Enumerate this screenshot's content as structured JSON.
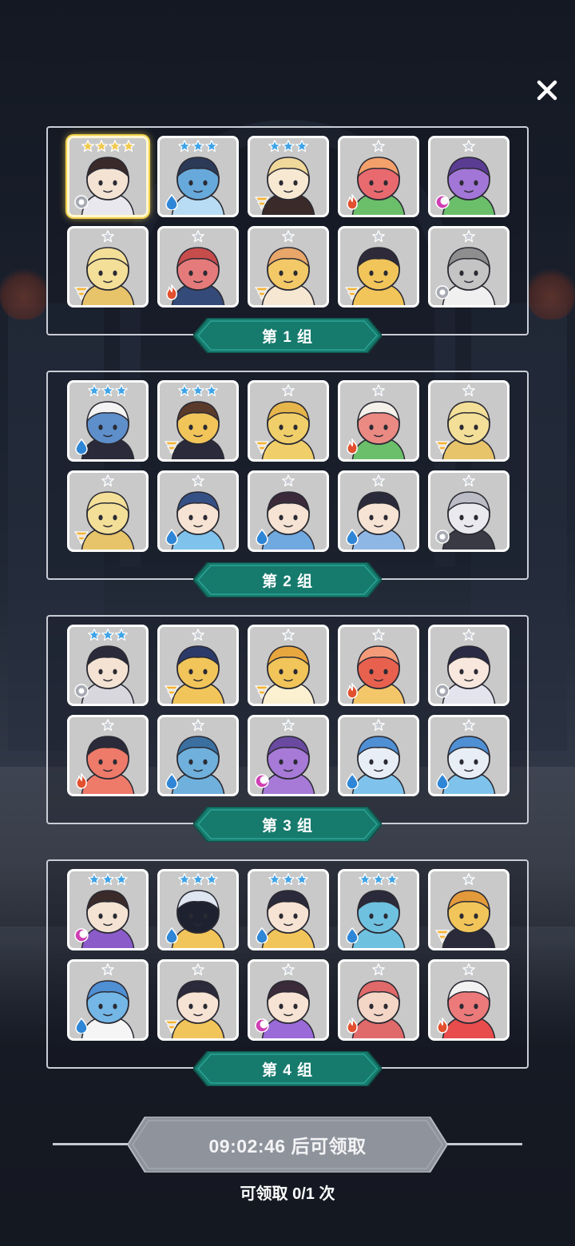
{
  "close_label": "✕",
  "groups": [
    {
      "label": "第 1 组",
      "heroes": [
        {
          "name": "hero-ninja-white-mask",
          "stars": 4,
          "star_color": "gold",
          "element": "light",
          "skin": "#f4e3d3",
          "hair": "#3a2a2a",
          "accent": "#e8e8ee",
          "highlight": true
        },
        {
          "name": "hero-blue-dragon",
          "stars": 3,
          "star_color": "blue",
          "element": "water",
          "skin": "#67a9da",
          "hair": "#2c3a57",
          "accent": "#b8dcf3"
        },
        {
          "name": "hero-blonde-boy",
          "stars": 3,
          "star_color": "blue",
          "element": "earth",
          "skin": "#f7e8d2",
          "hair": "#f0d79a",
          "accent": "#3a2a2a"
        },
        {
          "name": "hero-red-chomper",
          "stars": 1,
          "star_color": "silver",
          "element": "fire",
          "skin": "#e86a6f",
          "hair": "#f4a06b",
          "accent": "#6bbf6a"
        },
        {
          "name": "hero-purple-chomper",
          "stars": 1,
          "star_color": "silver",
          "element": "dark",
          "skin": "#a276d6",
          "hair": "#5b3c93",
          "accent": "#6bbf6a"
        },
        {
          "name": "hero-yellow-blob",
          "stars": 1,
          "star_color": "silver",
          "element": "earth",
          "skin": "#f3df98",
          "hair": "#f3df98",
          "accent": "#e7c46a"
        },
        {
          "name": "hero-red-cat",
          "stars": 1,
          "star_color": "silver",
          "element": "fire",
          "skin": "#e57a7a",
          "hair": "#c74c4c",
          "accent": "#344a78"
        },
        {
          "name": "hero-pizza-blob",
          "stars": 1,
          "star_color": "silver",
          "element": "earth",
          "skin": "#f3c968",
          "hair": "#e9a66a",
          "accent": "#f5e7d2"
        },
        {
          "name": "hero-yellow-king",
          "stars": 1,
          "star_color": "silver",
          "element": "earth",
          "skin": "#f2c55a",
          "hair": "#2e2a3a",
          "accent": "#f2c55a"
        },
        {
          "name": "hero-gray-mummy",
          "stars": 1,
          "star_color": "silver",
          "element": "light",
          "skin": "#c4c4c4",
          "hair": "#8e8e8e",
          "accent": "#f0f0f0"
        }
      ]
    },
    {
      "label": "第 2 组",
      "heroes": [
        {
          "name": "hero-blue-bandaged",
          "stars": 3,
          "star_color": "blue",
          "element": "water",
          "skin": "#5e8fca",
          "hair": "#f3f3f3",
          "accent": "#2a2a3a"
        },
        {
          "name": "hero-yellow-tree",
          "stars": 3,
          "star_color": "blue",
          "element": "earth",
          "skin": "#f2c55a",
          "hair": "#5a3a2a",
          "accent": "#2a2a3a"
        },
        {
          "name": "hero-yellow-fluff",
          "stars": 1,
          "star_color": "silver",
          "element": "earth",
          "skin": "#f0cf6a",
          "hair": "#e6b54b",
          "accent": "#f0cf6a"
        },
        {
          "name": "hero-red-bandaged",
          "stars": 1,
          "star_color": "silver",
          "element": "fire",
          "skin": "#ea8a83",
          "hair": "#f4f0ea",
          "accent": "#6bbf6a"
        },
        {
          "name": "hero-yellow-blob-b",
          "stars": 1,
          "star_color": "silver",
          "element": "earth",
          "skin": "#f3df98",
          "hair": "#f3df98",
          "accent": "#e7c46a"
        },
        {
          "name": "hero-yellow-blob-c",
          "stars": 1,
          "star_color": "silver",
          "element": "earth",
          "skin": "#f3df98",
          "hair": "#f3df98",
          "accent": "#e7c46a"
        },
        {
          "name": "hero-blue-visor-knight",
          "stars": 1,
          "star_color": "silver",
          "element": "water",
          "skin": "#f7e3d3",
          "hair": "#355085",
          "accent": "#7fc3ec"
        },
        {
          "name": "hero-blue-witch",
          "stars": 1,
          "star_color": "silver",
          "element": "water",
          "skin": "#f7e3d3",
          "hair": "#3a2a3a",
          "accent": "#6fa9e0"
        },
        {
          "name": "hero-armored-knight",
          "stars": 1,
          "star_color": "silver",
          "element": "water",
          "skin": "#f7e3d3",
          "hair": "#2a2a3a",
          "accent": "#8fb7e6"
        },
        {
          "name": "hero-white-helmet",
          "stars": 1,
          "star_color": "silver",
          "element": "light",
          "skin": "#e9e9ee",
          "hair": "#bcbcc6",
          "accent": "#3a3a44"
        }
      ]
    },
    {
      "label": "第 3 组",
      "heroes": [
        {
          "name": "hero-dark-ponytail",
          "stars": 3,
          "star_color": "blue",
          "element": "light",
          "skin": "#f4e3d3",
          "hair": "#2a2a3a",
          "accent": "#d7d7dd"
        },
        {
          "name": "hero-yellow-skull",
          "stars": 1,
          "star_color": "silver",
          "element": "earth",
          "skin": "#f2c55a",
          "hair": "#2c3a6a",
          "accent": "#f2c55a"
        },
        {
          "name": "hero-yellow-lion",
          "stars": 1,
          "star_color": "silver",
          "element": "earth",
          "skin": "#f2c55a",
          "hair": "#e8a63e",
          "accent": "#fbf0d0"
        },
        {
          "name": "hero-red-phoenix",
          "stars": 1,
          "star_color": "silver",
          "element": "fire",
          "skin": "#e8614f",
          "hair": "#f49c7a",
          "accent": "#f4c66a"
        },
        {
          "name": "hero-black-hair-girl",
          "stars": 1,
          "star_color": "silver",
          "element": "light",
          "skin": "#f7e7dd",
          "hair": "#2a2a44",
          "accent": "#e4e4ee"
        },
        {
          "name": "hero-red-fortress",
          "stars": 1,
          "star_color": "silver",
          "element": "fire",
          "skin": "#ee7a6a",
          "hair": "#2a2a3a",
          "accent": "#ee7a6a"
        },
        {
          "name": "hero-blue-key",
          "stars": 1,
          "star_color": "silver",
          "element": "water",
          "skin": "#6fb0dc",
          "hair": "#3a6fa0",
          "accent": "#6fb0dc"
        },
        {
          "name": "hero-purple-key",
          "stars": 1,
          "star_color": "silver",
          "element": "dark",
          "skin": "#a77ad8",
          "hair": "#6a4aa0",
          "accent": "#a77ad8"
        },
        {
          "name": "hero-blue-mech-a",
          "stars": 1,
          "star_color": "silver",
          "element": "water",
          "skin": "#e8eef6",
          "hair": "#4f8fd3",
          "accent": "#7fc3ec"
        },
        {
          "name": "hero-blue-mech-b",
          "stars": 1,
          "star_color": "silver",
          "element": "water",
          "skin": "#e8eef6",
          "hair": "#4f8fd3",
          "accent": "#7fc3ec"
        }
      ]
    },
    {
      "label": "第 4 组",
      "heroes": [
        {
          "name": "hero-purple-mask-ninja",
          "stars": 3,
          "star_color": "blue",
          "element": "dark",
          "skin": "#f4e3d3",
          "hair": "#3a2a2a",
          "accent": "#8a5bc9"
        },
        {
          "name": "hero-hooded-mage",
          "stars": 3,
          "star_color": "blue",
          "element": "water",
          "skin": "#1e2230",
          "hair": "#dfe6f2",
          "accent": "#f2c55a"
        },
        {
          "name": "hero-crowned-prince",
          "stars": 3,
          "star_color": "blue",
          "element": "water",
          "skin": "#f7e3d3",
          "hair": "#2a2a3a",
          "accent": "#f2c55a"
        },
        {
          "name": "hero-blue-tree",
          "stars": 3,
          "star_color": "blue",
          "element": "water",
          "skin": "#6fc1e0",
          "hair": "#2a2a3a",
          "accent": "#6fc1e0"
        },
        {
          "name": "hero-yellow-tree-b",
          "stars": 1,
          "star_color": "silver",
          "element": "earth",
          "skin": "#f2c55a",
          "hair": "#e39a3a",
          "accent": "#2a2a3a"
        },
        {
          "name": "hero-blue-lion",
          "stars": 1,
          "star_color": "silver",
          "element": "water",
          "skin": "#74b7e6",
          "hair": "#4f8fd3",
          "accent": "#f5f5f5"
        },
        {
          "name": "hero-gold-helmet",
          "stars": 1,
          "star_color": "silver",
          "element": "earth",
          "skin": "#f7e3d3",
          "hair": "#2a2a3a",
          "accent": "#f2c55a"
        },
        {
          "name": "hero-purple-witch",
          "stars": 1,
          "star_color": "silver",
          "element": "dark",
          "skin": "#f7e3d3",
          "hair": "#3a2a3a",
          "accent": "#9a6ad8"
        },
        {
          "name": "hero-red-ring",
          "stars": 1,
          "star_color": "silver",
          "element": "fire",
          "skin": "#f4d6c6",
          "hair": "#e06a6a",
          "accent": "#e06a6a"
        },
        {
          "name": "hero-pink-bandit",
          "stars": 1,
          "star_color": "silver",
          "element": "fire",
          "skin": "#ec7a7a",
          "hair": "#f2f2f2",
          "accent": "#e84c4c"
        }
      ]
    }
  ],
  "footer": {
    "claim_button": "09:02:46 后可领取",
    "claim_count": "可领取 0/1 次"
  },
  "colors": {
    "group_label": "#167a6d",
    "group_label_border": "#0f5249",
    "claim_button": "#8f939c",
    "star_gold": "#f2c94c",
    "star_blue": "#3fa3e8",
    "star_silver": "#c9cdd3",
    "element_water": "#2f86d6",
    "element_fire": "#e2502f",
    "element_earth": "#f2b233",
    "element_light": "#a8abb3",
    "element_dark": "#cf3fb3"
  }
}
